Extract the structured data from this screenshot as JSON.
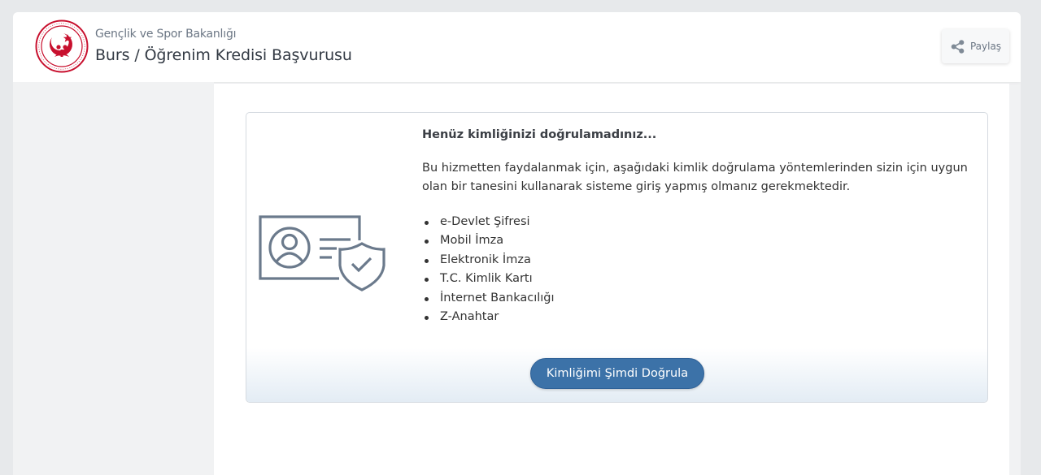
{
  "header": {
    "ministry": "Gençlik ve Spor Bakanlığı",
    "service_title": "Burs / Öğrenim Kredisi Başvurusu",
    "share_label": "Paylaş"
  },
  "card": {
    "title": "Henüz kimliğinizi doğrulamadınız...",
    "description": "Bu hizmetten faydalanmak için, aşağıdaki kimlik doğrulama yöntemlerinden sizin için uygun olan bir tanesini kullanarak sisteme giriş yapmış olmanız gerekmektedir.",
    "methods": [
      "e-Devlet Şifresi",
      "Mobil İmza",
      "Elektronik İmza",
      "T.C. Kimlik Kartı",
      "İnternet Bankacılığı",
      "Z-Anahtar"
    ],
    "verify_button": "Kimliğimi Şimdi Doğrula"
  },
  "icons": {
    "logo": "ministry-emblem-icon",
    "share": "share-icon",
    "illustration": "id-card-shield-icon"
  },
  "colors": {
    "brand_red": "#c8102e",
    "button_blue": "#3c72a8",
    "illustration_gray": "#6b7a8c"
  }
}
